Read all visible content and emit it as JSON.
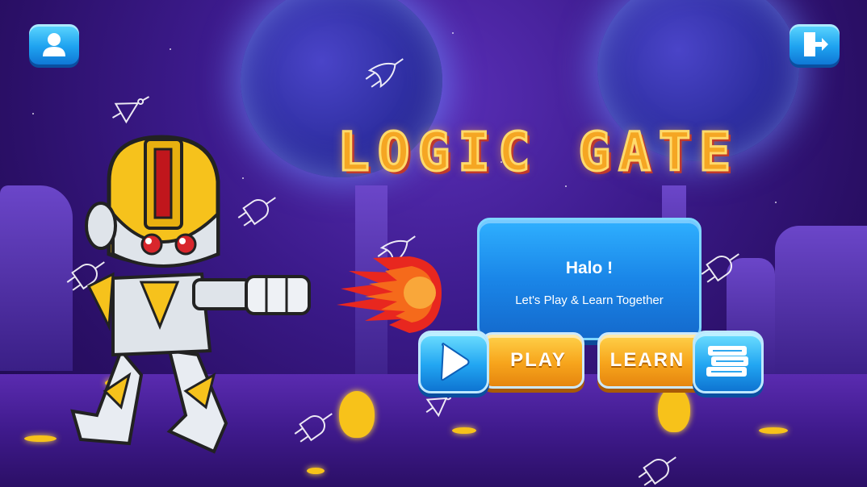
{
  "game": {
    "title": "LOGIC GATE",
    "panel": {
      "greeting": "Halo !",
      "subtitle": "Let's Play & Learn Together"
    },
    "buttons": {
      "play_label": "PLAY",
      "learn_label": "LEARN"
    },
    "top_left_icon": "user-profile-icon",
    "top_right_icon": "logout-icon"
  },
  "colors": {
    "background": "#3b1a8a",
    "panel": "#1a86e8",
    "button_orange": "#f7a51c",
    "button_blue": "#22a6f2",
    "title": "#f5a623"
  }
}
